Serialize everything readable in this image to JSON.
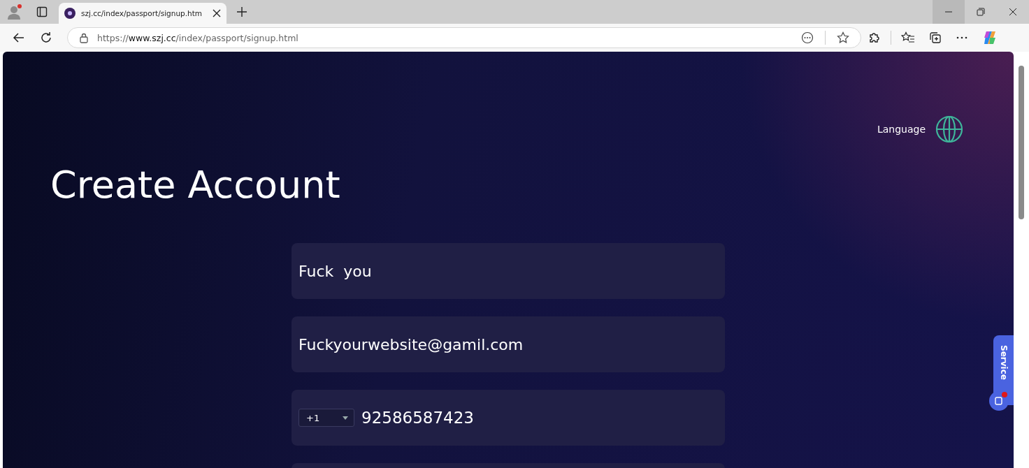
{
  "browser": {
    "tab": {
      "title": "szj.cc/index/passport/signup.htm",
      "selected": true
    },
    "address": {
      "scheme": "https://",
      "host": "www.szj.cc",
      "path": "/index/passport/signup.html"
    }
  },
  "page": {
    "language": "Language",
    "title": "Create Account",
    "fields": [
      {
        "kind": "text",
        "value": "Fuck  you"
      },
      {
        "kind": "text",
        "value": "Fuckyourwebsite@gamil.com"
      },
      {
        "kind": "phone",
        "code": "+1",
        "value": "92586587423"
      },
      {
        "kind": "blank"
      }
    ],
    "service": "Service"
  }
}
